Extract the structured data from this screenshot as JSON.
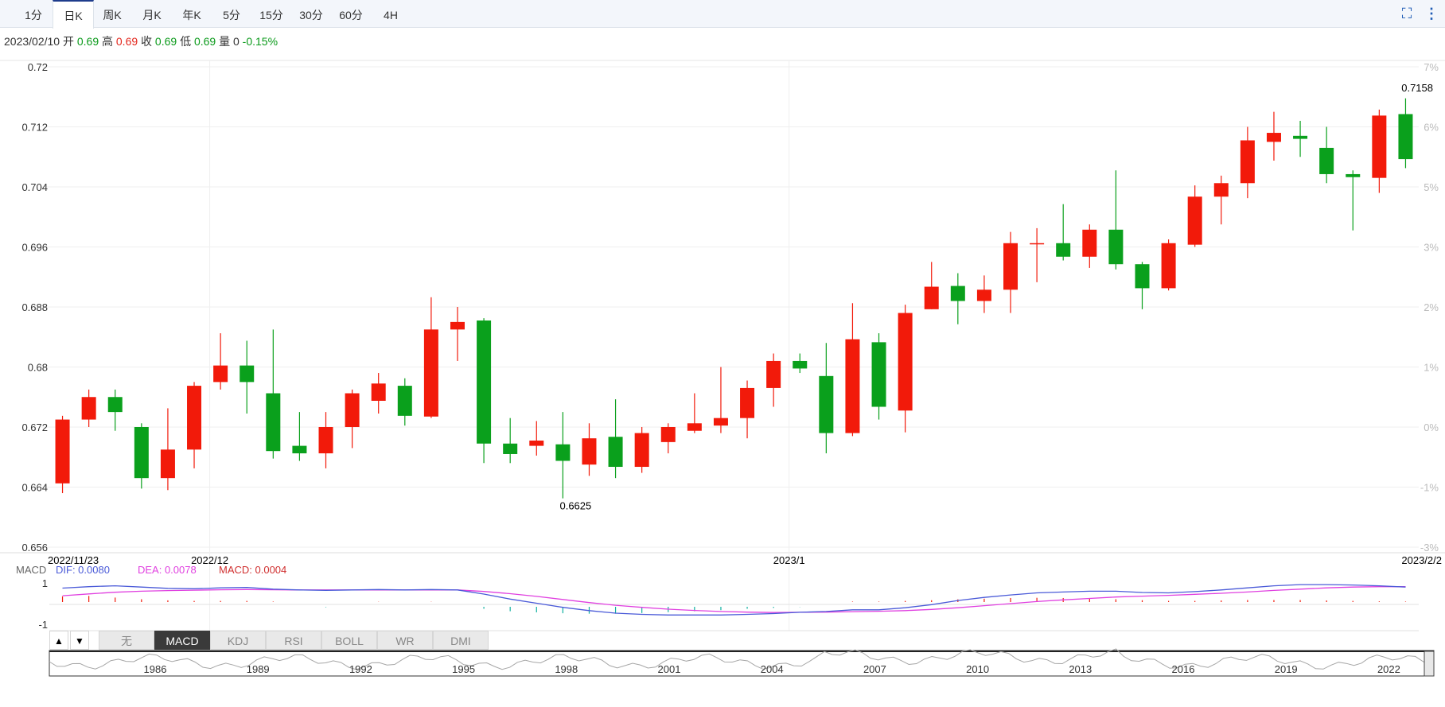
{
  "tabs": [
    "1分",
    "日K",
    "周K",
    "月K",
    "年K",
    "5分",
    "15分",
    "30分",
    "60分",
    "4H"
  ],
  "active_tab": "日K",
  "info": {
    "date": "2023/02/10",
    "open_label": "开",
    "open": "0.69",
    "high_label": "高",
    "high": "0.69",
    "close_label": "收",
    "close": "0.69",
    "low_label": "低",
    "low": "0.69",
    "vol_label": "量",
    "vol": "0",
    "change": "-0.15%"
  },
  "macd_legend": {
    "name": "MACD",
    "dif": "DIF: 0.0080",
    "dea": "DEA: 0.0078",
    "macd": "MACD: 0.0004"
  },
  "indicators": [
    "无",
    "MACD",
    "KDJ",
    "RSI",
    "BOLL",
    "WR",
    "DMI"
  ],
  "active_indicator": "MACD",
  "arrows": [
    "▲",
    "▼"
  ],
  "colors": {
    "up": "#f21a0a",
    "down": "#0aa01c",
    "dif": "#4a5ad8",
    "dea": "#e040e0",
    "tab_accent": "#1e3c8c"
  },
  "chart_data": {
    "type": "candlestick",
    "y_ticks": [
      "0.72",
      "0.712",
      "0.704",
      "0.696",
      "0.688",
      "0.68",
      "0.672",
      "0.664",
      "0.656"
    ],
    "ylim": [
      0.656,
      0.72
    ],
    "pct_ticks": [
      "7%",
      "6%",
      "5%",
      "3%",
      "2%",
      "1%",
      "0%",
      "-1%",
      "-3%"
    ],
    "x_labels": [
      "2022/11/23",
      "2022/12",
      "2023/1",
      "2023/2/2"
    ],
    "annotations": {
      "max": "0.7158",
      "min": "0.6625"
    },
    "candles": [
      {
        "o": 0.6645,
        "c": 0.673,
        "h": 0.6735,
        "l": 0.6632
      },
      {
        "o": 0.673,
        "c": 0.676,
        "h": 0.677,
        "l": 0.672
      },
      {
        "o": 0.676,
        "c": 0.674,
        "h": 0.677,
        "l": 0.6715
      },
      {
        "o": 0.672,
        "c": 0.6652,
        "h": 0.6725,
        "l": 0.6638
      },
      {
        "o": 0.6652,
        "c": 0.669,
        "h": 0.6745,
        "l": 0.6636
      },
      {
        "o": 0.669,
        "c": 0.6775,
        "h": 0.678,
        "l": 0.6665
      },
      {
        "o": 0.678,
        "c": 0.6802,
        "h": 0.6845,
        "l": 0.677
      },
      {
        "o": 0.6802,
        "c": 0.678,
        "h": 0.6835,
        "l": 0.6738
      },
      {
        "o": 0.6765,
        "c": 0.6688,
        "h": 0.685,
        "l": 0.6678
      },
      {
        "o": 0.6695,
        "c": 0.6685,
        "h": 0.674,
        "l": 0.6675
      },
      {
        "o": 0.6685,
        "c": 0.672,
        "h": 0.674,
        "l": 0.6665
      },
      {
        "o": 0.672,
        "c": 0.6765,
        "h": 0.677,
        "l": 0.6692
      },
      {
        "o": 0.6755,
        "c": 0.6778,
        "h": 0.6792,
        "l": 0.6738
      },
      {
        "o": 0.6775,
        "c": 0.6735,
        "h": 0.6785,
        "l": 0.6722
      },
      {
        "o": 0.6734,
        "c": 0.685,
        "h": 0.6893,
        "l": 0.6732
      },
      {
        "o": 0.685,
        "c": 0.686,
        "h": 0.688,
        "l": 0.6808
      },
      {
        "o": 0.6862,
        "c": 0.6698,
        "h": 0.6865,
        "l": 0.6672
      },
      {
        "o": 0.6698,
        "c": 0.6684,
        "h": 0.6732,
        "l": 0.6672
      },
      {
        "o": 0.6695,
        "c": 0.6702,
        "h": 0.6728,
        "l": 0.6682
      },
      {
        "o": 0.6697,
        "c": 0.6675,
        "h": 0.674,
        "l": 0.6625
      },
      {
        "o": 0.667,
        "c": 0.6705,
        "h": 0.6725,
        "l": 0.6655
      },
      {
        "o": 0.6707,
        "c": 0.6667,
        "h": 0.6757,
        "l": 0.6652
      },
      {
        "o": 0.6667,
        "c": 0.6712,
        "h": 0.672,
        "l": 0.6659
      },
      {
        "o": 0.67,
        "c": 0.672,
        "h": 0.6725,
        "l": 0.6685
      },
      {
        "o": 0.6715,
        "c": 0.6725,
        "h": 0.6765,
        "l": 0.6712
      },
      {
        "o": 0.6722,
        "c": 0.6732,
        "h": 0.68,
        "l": 0.6712
      },
      {
        "o": 0.6732,
        "c": 0.6772,
        "h": 0.6782,
        "l": 0.6705
      },
      {
        "o": 0.6772,
        "c": 0.6808,
        "h": 0.6818,
        "l": 0.6747
      },
      {
        "o": 0.6808,
        "c": 0.6798,
        "h": 0.6818,
        "l": 0.6792
      },
      {
        "o": 0.6788,
        "c": 0.6712,
        "h": 0.6832,
        "l": 0.6685
      },
      {
        "o": 0.6712,
        "c": 0.6837,
        "h": 0.6885,
        "l": 0.6708
      },
      {
        "o": 0.6833,
        "c": 0.6747,
        "h": 0.6845,
        "l": 0.673
      },
      {
        "o": 0.6742,
        "c": 0.6872,
        "h": 0.6883,
        "l": 0.6713
      },
      {
        "o": 0.6877,
        "c": 0.6907,
        "h": 0.694,
        "l": 0.6877
      },
      {
        "o": 0.6908,
        "c": 0.6888,
        "h": 0.6925,
        "l": 0.6857
      },
      {
        "o": 0.6888,
        "c": 0.6903,
        "h": 0.6922,
        "l": 0.6872
      },
      {
        "o": 0.6903,
        "c": 0.6965,
        "h": 0.698,
        "l": 0.6872
      },
      {
        "o": 0.6964,
        "c": 0.6965,
        "h": 0.6985,
        "l": 0.6913
      },
      {
        "o": 0.6965,
        "c": 0.6947,
        "h": 0.7017,
        "l": 0.6942
      },
      {
        "o": 0.6947,
        "c": 0.6983,
        "h": 0.699,
        "l": 0.6932
      },
      {
        "o": 0.6983,
        "c": 0.6937,
        "h": 0.7062,
        "l": 0.693
      },
      {
        "o": 0.6937,
        "c": 0.6905,
        "h": 0.694,
        "l": 0.6877
      },
      {
        "o": 0.6905,
        "c": 0.6965,
        "h": 0.697,
        "l": 0.6902
      },
      {
        "o": 0.6963,
        "c": 0.7027,
        "h": 0.7042,
        "l": 0.696
      },
      {
        "o": 0.7027,
        "c": 0.7045,
        "h": 0.7055,
        "l": 0.699
      },
      {
        "o": 0.7045,
        "c": 0.7102,
        "h": 0.712,
        "l": 0.7025
      },
      {
        "o": 0.71,
        "c": 0.7112,
        "h": 0.714,
        "l": 0.7075
      },
      {
        "o": 0.7108,
        "c": 0.7104,
        "h": 0.7128,
        "l": 0.708
      },
      {
        "o": 0.7092,
        "c": 0.7057,
        "h": 0.712,
        "l": 0.7045
      },
      {
        "o": 0.7057,
        "c": 0.7053,
        "h": 0.7062,
        "l": 0.6982
      },
      {
        "o": 0.7052,
        "c": 0.7135,
        "h": 0.7143,
        "l": 0.7032
      },
      {
        "o": 0.7137,
        "c": 0.7077,
        "h": 0.7158,
        "l": 0.7065
      }
    ],
    "macd": {
      "ylim": [
        -1,
        1
      ],
      "y_ticks": [
        "1",
        "-1"
      ],
      "dif": [
        0.75,
        0.82,
        0.86,
        0.8,
        0.74,
        0.72,
        0.76,
        0.78,
        0.7,
        0.66,
        0.64,
        0.66,
        0.68,
        0.66,
        0.68,
        0.66,
        0.46,
        0.22,
        0.02,
        -0.18,
        -0.34,
        -0.46,
        -0.52,
        -0.55,
        -0.55,
        -0.55,
        -0.52,
        -0.48,
        -0.42,
        -0.38,
        -0.3,
        -0.3,
        -0.2,
        -0.05,
        0.15,
        0.3,
        0.42,
        0.52,
        0.56,
        0.6,
        0.6,
        0.54,
        0.52,
        0.58,
        0.66,
        0.76,
        0.86,
        0.92,
        0.92,
        0.9,
        0.86,
        0.8
      ],
      "dea": [
        0.38,
        0.47,
        0.55,
        0.6,
        0.63,
        0.65,
        0.67,
        0.68,
        0.67,
        0.66,
        0.66,
        0.66,
        0.66,
        0.66,
        0.66,
        0.66,
        0.59,
        0.48,
        0.35,
        0.2,
        0.05,
        -0.08,
        -0.18,
        -0.27,
        -0.33,
        -0.38,
        -0.41,
        -0.43,
        -0.42,
        -0.41,
        -0.39,
        -0.37,
        -0.34,
        -0.28,
        -0.2,
        -0.1,
        0.0,
        0.1,
        0.18,
        0.25,
        0.32,
        0.36,
        0.4,
        0.45,
        0.5,
        0.56,
        0.64,
        0.7,
        0.76,
        0.8,
        0.82,
        0.82
      ],
      "hist": [
        0.5,
        0.55,
        0.4,
        0.25,
        0.15,
        0.1,
        0.1,
        0.1,
        0.04,
        0.0,
        -0.04,
        0.0,
        0.02,
        0.0,
        0.02,
        0.0,
        -0.18,
        -0.4,
        -0.5,
        -0.58,
        -0.62,
        -0.62,
        -0.56,
        -0.48,
        -0.4,
        -0.3,
        -0.18,
        -0.1,
        -0.02,
        0.0,
        0.04,
        0.04,
        0.1,
        0.16,
        0.24,
        0.3,
        0.36,
        0.38,
        0.36,
        0.3,
        0.25,
        0.16,
        0.1,
        0.1,
        0.14,
        0.18,
        0.18,
        0.18,
        0.14,
        0.1,
        0.06,
        0.04
      ]
    },
    "navigator": {
      "x_labels": [
        "1986",
        "1989",
        "1992",
        "1995",
        "1998",
        "2001",
        "2004",
        "2007",
        "2010",
        "2013",
        "2016",
        "2019",
        "2022"
      ]
    }
  }
}
